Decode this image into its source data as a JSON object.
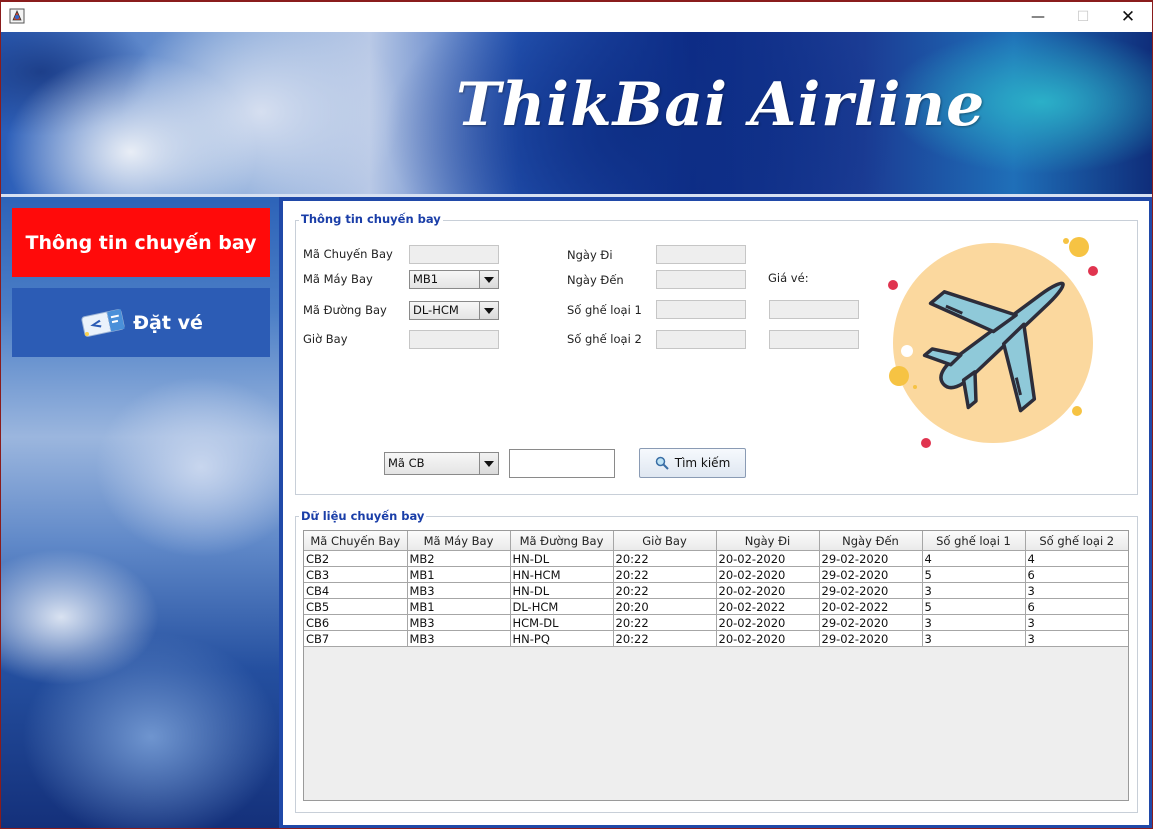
{
  "window": {
    "min_glyph": "—",
    "max_glyph": "☐",
    "close_glyph": "✕"
  },
  "banner": {
    "title": "ThikBai Airline"
  },
  "sidebar": {
    "items": [
      {
        "label": "Thông tin chuyến bay",
        "color": "#ff0a0a"
      },
      {
        "label": "Đặt vé",
        "color": "#2c5cb5"
      }
    ]
  },
  "flight_info": {
    "group_title": "Thông tin chuyến bay",
    "ma_chuyen_bay_label": "Mã Chuyến Bay",
    "ma_chuyen_bay_value": "",
    "ma_may_bay_label": "Mã Máy Bay",
    "ma_may_bay_value": "MB1",
    "ma_duong_bay_label": "Mã Đường Bay",
    "ma_duong_bay_value": "DL-HCM",
    "gio_bay_label": "Giờ Bay",
    "gio_bay_value": "",
    "ngay_di_label": "Ngày Đi",
    "ngay_den_label": "Ngày Đến",
    "so_ghe_1_label": "Số ghế loại 1",
    "so_ghe_2_label": "Số ghế loại 2",
    "gia_ve_label": "Giá vé:"
  },
  "search": {
    "field_select": "Mã CB",
    "query": "",
    "button_label": "Tìm kiếm"
  },
  "table": {
    "group_title": "Dữ liệu chuyến bay",
    "columns": [
      "Mã Chuyến Bay",
      "Mã Máy Bay",
      "Mã Đường Bay",
      "Giờ Bay",
      "Ngày Đi",
      "Ngày Đến",
      "Số ghế loại 1",
      "Số ghế loại 2"
    ],
    "rows": [
      [
        "CB2",
        "MB2",
        "HN-DL",
        "20:22",
        "20-02-2020",
        "29-02-2020",
        "4",
        "4"
      ],
      [
        "CB3",
        "MB1",
        "HN-HCM",
        "20:22",
        "20-02-2020",
        "29-02-2020",
        "5",
        "6"
      ],
      [
        "CB4",
        "MB3",
        "HN-DL",
        "20:22",
        "20-02-2020",
        "29-02-2020",
        "3",
        "3"
      ],
      [
        "CB5",
        "MB1",
        "DL-HCM",
        "20:20",
        "20-02-2022",
        "20-02-2022",
        "5",
        "6"
      ],
      [
        "CB6",
        "MB3",
        "HCM-DL",
        "20:22",
        "20-02-2020",
        "29-02-2020",
        "3",
        "3"
      ],
      [
        "CB7",
        "MB3",
        "HN-PQ",
        "20:22",
        "20-02-2020",
        "29-02-2020",
        "3",
        "3"
      ]
    ]
  },
  "colors": {
    "accent_red": "#ff0a0a",
    "accent_blue": "#2c5cb5",
    "group_title": "#1a3ea8",
    "illustration_circle": "#fbd89e",
    "plane": "#8fc9d9"
  }
}
